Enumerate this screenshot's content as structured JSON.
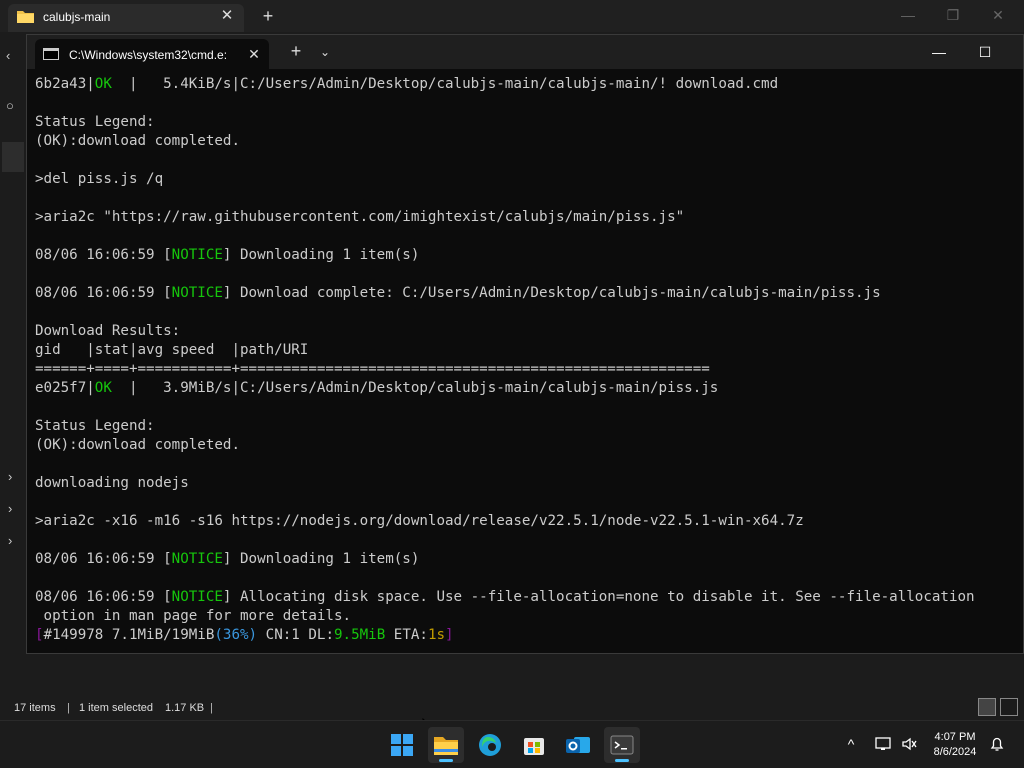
{
  "explorer": {
    "tab_title": "calubjs-main",
    "tab_close": "✕",
    "new_tab": "+",
    "status": {
      "items_count": "17 items",
      "selection": "1 item selected",
      "size": "1.17 KB"
    }
  },
  "terminal": {
    "tab_title": "C:\\Windows\\system32\\cmd.e:",
    "tab_close": "✕",
    "new_tab": "+",
    "dropdown": "⌄",
    "lines": [
      {
        "segments": [
          {
            "t": "6b2a43|"
          },
          {
            "t": "OK",
            "c": "green"
          },
          {
            "t": "  |   5.4KiB/s|C:/Users/Admin/Desktop/calubjs-main/calubjs-main/! download.cmd"
          }
        ]
      },
      {
        "segments": [
          {
            "t": ""
          }
        ]
      },
      {
        "segments": [
          {
            "t": "Status Legend:"
          }
        ]
      },
      {
        "segments": [
          {
            "t": "(OK):download completed."
          }
        ]
      },
      {
        "segments": [
          {
            "t": ""
          }
        ]
      },
      {
        "segments": [
          {
            "t": ">del piss.js /q"
          }
        ]
      },
      {
        "segments": [
          {
            "t": ""
          }
        ]
      },
      {
        "segments": [
          {
            "t": ">aria2c \"https://raw.githubusercontent.com/imightexist/calubjs/main/piss.js\""
          }
        ]
      },
      {
        "segments": [
          {
            "t": ""
          }
        ]
      },
      {
        "segments": [
          {
            "t": "08/06 16:06:59 ["
          },
          {
            "t": "NOTICE",
            "c": "green"
          },
          {
            "t": "] Downloading 1 item(s)"
          }
        ]
      },
      {
        "segments": [
          {
            "t": ""
          }
        ]
      },
      {
        "segments": [
          {
            "t": "08/06 16:06:59 ["
          },
          {
            "t": "NOTICE",
            "c": "green"
          },
          {
            "t": "] Download complete: C:/Users/Admin/Desktop/calubjs-main/calubjs-main/piss.js"
          }
        ]
      },
      {
        "segments": [
          {
            "t": ""
          }
        ]
      },
      {
        "segments": [
          {
            "t": "Download Results:"
          }
        ]
      },
      {
        "segments": [
          {
            "t": "gid   |stat|avg speed  |path/URI"
          }
        ]
      },
      {
        "segments": [
          {
            "t": "======+====+===========+======================================================="
          }
        ]
      },
      {
        "segments": [
          {
            "t": "e025f7|"
          },
          {
            "t": "OK",
            "c": "green"
          },
          {
            "t": "  |   3.9MiB/s|C:/Users/Admin/Desktop/calubjs-main/calubjs-main/piss.js"
          }
        ]
      },
      {
        "segments": [
          {
            "t": ""
          }
        ]
      },
      {
        "segments": [
          {
            "t": "Status Legend:"
          }
        ]
      },
      {
        "segments": [
          {
            "t": "(OK):download completed."
          }
        ]
      },
      {
        "segments": [
          {
            "t": ""
          }
        ]
      },
      {
        "segments": [
          {
            "t": "downloading nodejs"
          }
        ]
      },
      {
        "segments": [
          {
            "t": ""
          }
        ]
      },
      {
        "segments": [
          {
            "t": ">aria2c -x16 -m16 -s16 https://nodejs.org/download/release/v22.5.1/node-v22.5.1-win-x64.7z"
          }
        ]
      },
      {
        "segments": [
          {
            "t": ""
          }
        ]
      },
      {
        "segments": [
          {
            "t": "08/06 16:06:59 ["
          },
          {
            "t": "NOTICE",
            "c": "green"
          },
          {
            "t": "] Downloading 1 item(s)"
          }
        ]
      },
      {
        "segments": [
          {
            "t": ""
          }
        ]
      },
      {
        "segments": [
          {
            "t": "08/06 16:06:59 ["
          },
          {
            "t": "NOTICE",
            "c": "green"
          },
          {
            "t": "] Allocating disk space. Use --file-allocation=none to disable it. See --file-allocation"
          }
        ]
      },
      {
        "segments": [
          {
            "t": " option in man page for more details."
          }
        ]
      },
      {
        "segments": [
          {
            "t": "[",
            "c": "magenta"
          },
          {
            "t": "#149978 7.1MiB/19MiB"
          },
          {
            "t": "(36%)",
            "c": "cyan"
          },
          {
            "t": " CN:1 DL:"
          },
          {
            "t": "9.5MiB",
            "c": "green"
          },
          {
            "t": " ETA:"
          },
          {
            "t": "1s",
            "c": "yellow"
          },
          {
            "t": "]",
            "c": "magenta"
          }
        ]
      }
    ]
  },
  "taskbar": {
    "clock_time": "4:07 PM",
    "clock_date": "8/6/2024",
    "tray_chevron": "^"
  },
  "colors": {
    "green": "#16c60c",
    "yellow": "#c19c00",
    "cyan": "#3a96dd",
    "magenta": "#881798",
    "accent": "#4cc2ff"
  },
  "icons": [
    "folder-icon",
    "cmd-icon",
    "start-icon",
    "file-explorer-icon",
    "edge-icon",
    "store-icon",
    "outlook-icon",
    "terminal-icon",
    "network-icon",
    "volume-icon",
    "notification-icon"
  ]
}
